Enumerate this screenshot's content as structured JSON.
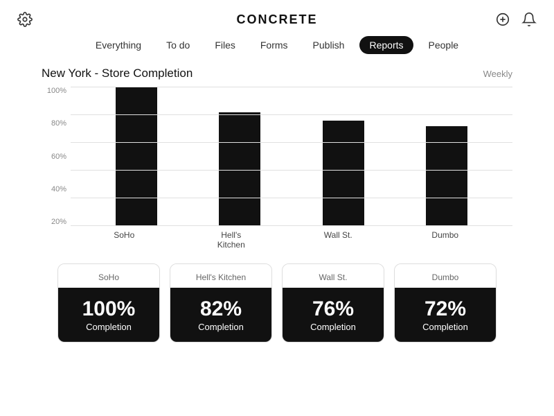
{
  "app": {
    "title": "CONCRETE"
  },
  "nav": {
    "items": [
      {
        "label": "Everything",
        "active": false
      },
      {
        "label": "To do",
        "active": false
      },
      {
        "label": "Files",
        "active": false
      },
      {
        "label": "Forms",
        "active": false
      },
      {
        "label": "Publish",
        "active": false
      },
      {
        "label": "Reports",
        "active": true
      },
      {
        "label": "People",
        "active": false
      }
    ]
  },
  "chart": {
    "title": "New York - Store Completion",
    "period": "Weekly",
    "y_labels": [
      "20%",
      "40%",
      "60%",
      "80%",
      "100%"
    ],
    "bars": [
      {
        "location": "SoHo",
        "value": 100,
        "height_pct": 1.0
      },
      {
        "location": "Hell's Kitchen",
        "value": 82,
        "height_pct": 0.82
      },
      {
        "location": "Wall St.",
        "value": 76,
        "height_pct": 0.76
      },
      {
        "location": "Dumbo",
        "value": 72,
        "height_pct": 0.72
      }
    ]
  },
  "cards": [
    {
      "location": "SoHo",
      "pct": "100%",
      "label": "Completion"
    },
    {
      "location": "Hell's Kitchen",
      "pct": "82%",
      "label": "Completion"
    },
    {
      "location": "Wall St.",
      "pct": "76%",
      "label": "Completion"
    },
    {
      "location": "Dumbo",
      "pct": "72%",
      "label": "Completion"
    }
  ]
}
